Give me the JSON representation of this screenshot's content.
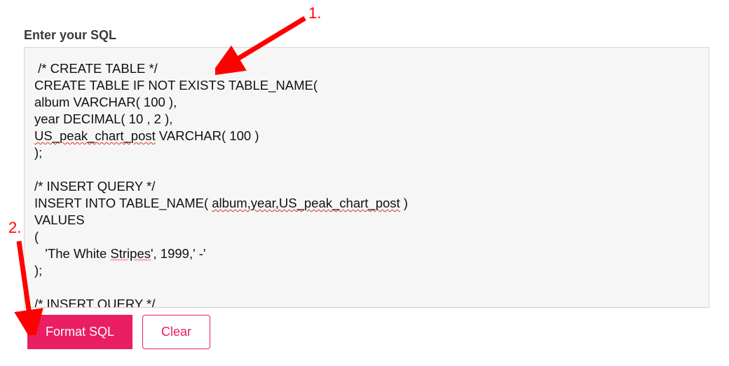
{
  "label": "Enter your SQL",
  "sql": {
    "l1": " /* CREATE TABLE */",
    "l2_a": "CREATE TABLE IF NOT EXISTS ",
    "l2_b": "TABLE_NAME(",
    "l3": "album VARCHAR( 100 ),",
    "l4": "year DECIMAL( 10 , 2 ),",
    "l5_a": "US_peak_chart_post",
    "l5_b": " VARCHAR( 100 )",
    "l6": ");",
    "l7": "",
    "l8": "/* INSERT QUERY */",
    "l9_a": "INSERT INTO TABLE_NAME( ",
    "l9_b": "album,year,US_peak_chart_post",
    "l9_c": " )",
    "l10": "VALUES",
    "l11": "(",
    "l12_a": "   'The White ",
    "l12_b": "Stripes",
    "l12_c": "', 1999,' -'",
    "l13": ");",
    "l14": "",
    "l15": "/* INSERT QUERY */"
  },
  "buttons": {
    "format": "Format SQL",
    "clear": "Clear"
  },
  "annotations": {
    "one": "1.",
    "two": "2."
  }
}
